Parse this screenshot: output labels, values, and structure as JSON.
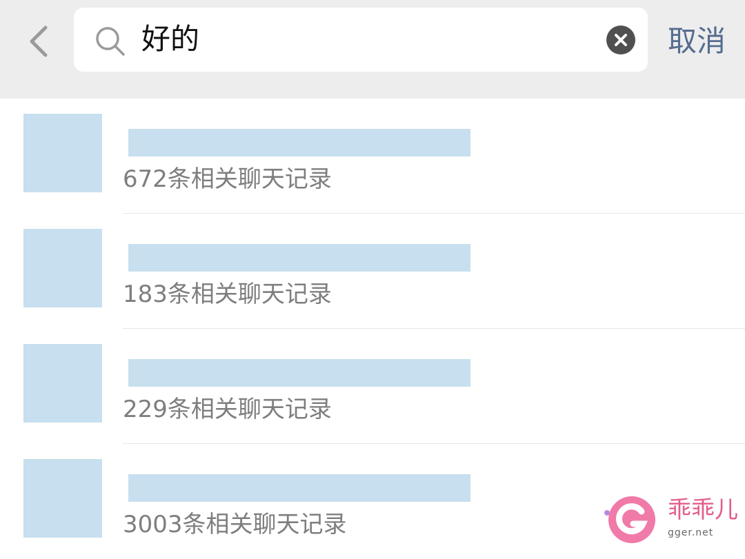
{
  "header": {
    "back_icon": "chevron-left-icon",
    "search": {
      "query": "好的",
      "search_icon": "search-icon",
      "clear_icon": "clear-circle-icon"
    },
    "cancel_label": "取消"
  },
  "results": [
    {
      "count_label": "672条相关聊天记录"
    },
    {
      "count_label": "183条相关聊天记录"
    },
    {
      "count_label": "229条相关聊天记录"
    },
    {
      "count_label": "3003条相关聊天记录"
    }
  ],
  "watermark": {
    "text": "乖乖儿",
    "domain": "gger.net"
  },
  "colors": {
    "accent": "#556c8f",
    "redaction": "#c7dfee",
    "topbar": "#ededed",
    "watermark": "#e25d8b"
  }
}
